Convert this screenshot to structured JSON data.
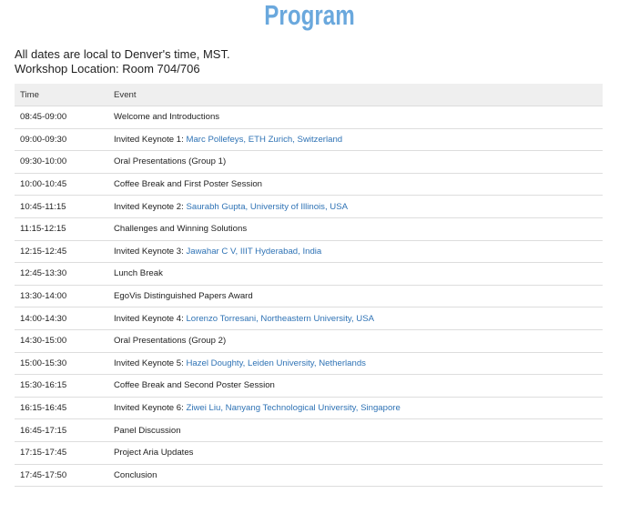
{
  "page": {
    "title": "Program",
    "intro_line1": "All dates are local to Denver's time, MST.",
    "intro_line2": "Workshop Location: Room 704/706"
  },
  "schedule": {
    "headers": {
      "time": "Time",
      "event": "Event"
    },
    "rows": [
      {
        "time": "08:45-09:00",
        "text": "Welcome and Introductions",
        "link": ""
      },
      {
        "time": "09:00-09:30",
        "text": "Invited Keynote 1: ",
        "link": "Marc Pollefeys, ETH Zurich, Switzerland"
      },
      {
        "time": "09:30-10:00",
        "text": "Oral Presentations (Group 1)",
        "link": ""
      },
      {
        "time": "10:00-10:45",
        "text": "Coffee Break and First Poster Session",
        "link": ""
      },
      {
        "time": "10:45-11:15",
        "text": "Invited Keynote 2: ",
        "link": "Saurabh Gupta, University of Illinois, USA"
      },
      {
        "time": "11:15-12:15",
        "text": "Challenges and Winning Solutions",
        "link": ""
      },
      {
        "time": "12:15-12:45",
        "text": "Invited Keynote 3: ",
        "link": "Jawahar C V, IIIT Hyderabad, India"
      },
      {
        "time": "12:45-13:30",
        "text": "Lunch Break",
        "link": ""
      },
      {
        "time": "13:30-14:00",
        "text": "EgoVis Distinguished Papers Award",
        "link": ""
      },
      {
        "time": "14:00-14:30",
        "text": "Invited Keynote 4: ",
        "link": "Lorenzo Torresani, Northeastern University, USA"
      },
      {
        "time": "14:30-15:00",
        "text": "Oral Presentations (Group 2)",
        "link": ""
      },
      {
        "time": "15:00-15:30",
        "text": "Invited Keynote 5: ",
        "link": "Hazel Doughty, Leiden University, Netherlands"
      },
      {
        "time": "15:30-16:15",
        "text": "Coffee Break and Second Poster Session",
        "link": ""
      },
      {
        "time": "16:15-16:45",
        "text": "Invited Keynote 6: ",
        "link": "Ziwei Liu, Nanyang Technological University, Singapore"
      },
      {
        "time": "16:45-17:15",
        "text": "Panel Discussion",
        "link": ""
      },
      {
        "time": "17:15-17:45",
        "text": "Project Aria Updates",
        "link": ""
      },
      {
        "time": "17:45-17:50",
        "text": "Conclusion",
        "link": ""
      }
    ]
  },
  "colors": {
    "title": "#6aa8dd",
    "link": "#2f73b5",
    "header_bg": "#efefef",
    "row_border": "#dddddd"
  }
}
